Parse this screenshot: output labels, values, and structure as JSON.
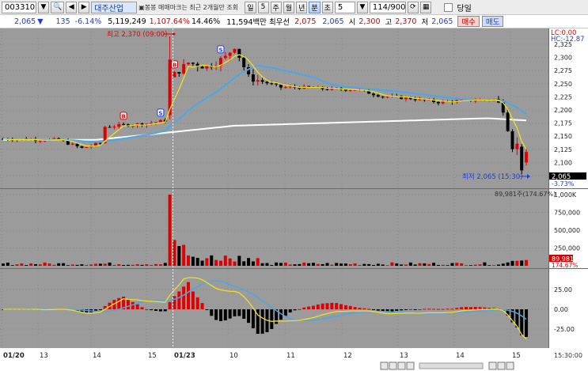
{
  "toolbar": {
    "code": "003310",
    "name": "대주산업",
    "notice": "▣봉봉 매매마크는 최근 2개월만 조회",
    "periods": [
      "일",
      "5",
      "주",
      "월",
      "년",
      "분",
      "초"
    ],
    "active_period": "분",
    "interval": "5",
    "count": "114/900",
    "today_label": "당일"
  },
  "quote": {
    "price": "2,065",
    "change": "135",
    "change_pct": "-6.14%",
    "volume": "5,119,249",
    "volume_ratio": "1,107.64%",
    "turnover": "14.46%",
    "amount": "11,594백만",
    "pref_label": "최우선",
    "ask": "2,075",
    "bid": "2,065",
    "open_label": "시",
    "open": "2,300",
    "high_label": "고",
    "high": "2,370",
    "low_label": "저",
    "low": "2,065",
    "buy_label": "매수",
    "sell_label": "매도"
  },
  "annotations": {
    "high": "최고 2,370 (09:00)",
    "low": "최저 2,065 (15:30)",
    "lc": "LC:0.00",
    "hc": "HC:-12.87",
    "last_price": "2,065",
    "last_pct": "-3.73%",
    "vol_label": "89,981주(174.67%)",
    "vol_last": "89,981",
    "vol_pct": "174.67%",
    "time": "15:30:00"
  },
  "axes": {
    "price_ticks": [
      "2,325",
      "2,300",
      "2,275",
      "2,250",
      "2,225",
      "2,200",
      "2,175",
      "2,150",
      "2,125",
      "2,100",
      "2,075"
    ],
    "volume_ticks": [
      "1,000K",
      "750,000",
      "500,000",
      "250,000"
    ],
    "osc_ticks": [
      "25.00",
      "0.00",
      "-25.00"
    ],
    "x_ticks": [
      "01/20",
      "13",
      "14",
      "15",
      "01/23",
      "10",
      "11",
      "12",
      "13",
      "14",
      "15"
    ]
  },
  "chart_data": {
    "type": "candlestick",
    "price_range": [
      2075,
      2340
    ],
    "volume_range": [
      0,
      1000000
    ],
    "osc_range": [
      -40,
      40
    ],
    "ma_colors": {
      "ma5": "#f0e020",
      "ma20": "#4aa8e8",
      "ma120": "#ffffff"
    },
    "signals": [
      {
        "index": 26,
        "label": "B",
        "color": "#d00000"
      },
      {
        "index": 34,
        "label": "S",
        "color": "#1f3fd1"
      },
      {
        "index": 37,
        "label": "B",
        "color": "#d00000"
      },
      {
        "index": 47,
        "label": "S",
        "color": "#1f3fd1"
      }
    ]
  }
}
